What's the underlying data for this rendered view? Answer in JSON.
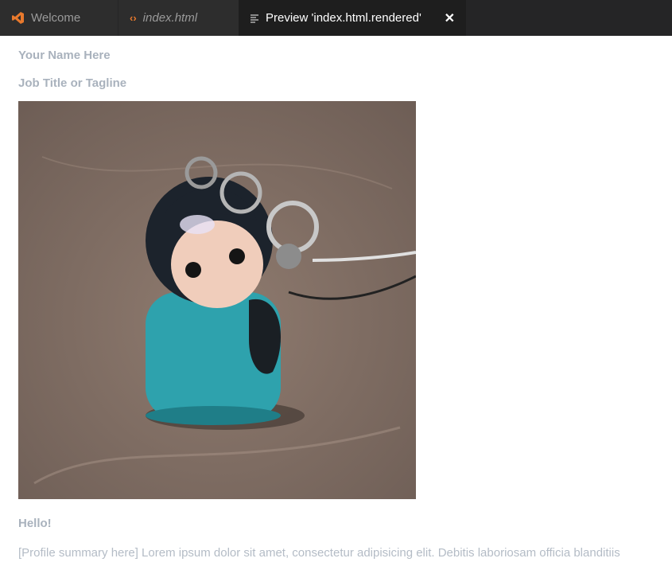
{
  "tabs": [
    {
      "label": "Welcome",
      "icon": "vscode-logo-icon",
      "active": false
    },
    {
      "label": "index.html",
      "icon": "code-file-icon",
      "active": false
    },
    {
      "label": "Preview 'index.html.rendered'",
      "icon": "preview-icon",
      "active": true,
      "close": "✕"
    }
  ],
  "page": {
    "name": "Your Name Here",
    "tagline": "Job Title or Tagline",
    "hello": "Hello!",
    "summary": "[Profile summary here] Lorem ipsum dolor sit amet, consectetur adipisicing elit. Debitis laboriosam officia blanditiis"
  },
  "photo": {
    "subject": "clay figurine keychain charm",
    "icon": "profile-photo-image"
  },
  "colors": {
    "tabbar": "#252526",
    "active_tab": "#1e1e1e",
    "accent": "#e8792d",
    "page_text": "#a9b2bd"
  }
}
